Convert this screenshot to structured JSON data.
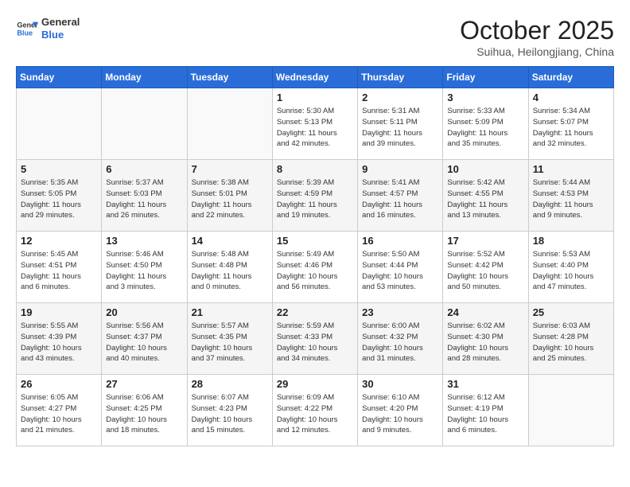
{
  "logo": {
    "line1": "General",
    "line2": "Blue"
  },
  "title": "October 2025",
  "subtitle": "Suihua, Heilongjiang, China",
  "weekdays": [
    "Sunday",
    "Monday",
    "Tuesday",
    "Wednesday",
    "Thursday",
    "Friday",
    "Saturday"
  ],
  "weeks": [
    [
      {
        "day": "",
        "detail": ""
      },
      {
        "day": "",
        "detail": ""
      },
      {
        "day": "",
        "detail": ""
      },
      {
        "day": "1",
        "detail": "Sunrise: 5:30 AM\nSunset: 5:13 PM\nDaylight: 11 hours\nand 42 minutes."
      },
      {
        "day": "2",
        "detail": "Sunrise: 5:31 AM\nSunset: 5:11 PM\nDaylight: 11 hours\nand 39 minutes."
      },
      {
        "day": "3",
        "detail": "Sunrise: 5:33 AM\nSunset: 5:09 PM\nDaylight: 11 hours\nand 35 minutes."
      },
      {
        "day": "4",
        "detail": "Sunrise: 5:34 AM\nSunset: 5:07 PM\nDaylight: 11 hours\nand 32 minutes."
      }
    ],
    [
      {
        "day": "5",
        "detail": "Sunrise: 5:35 AM\nSunset: 5:05 PM\nDaylight: 11 hours\nand 29 minutes."
      },
      {
        "day": "6",
        "detail": "Sunrise: 5:37 AM\nSunset: 5:03 PM\nDaylight: 11 hours\nand 26 minutes."
      },
      {
        "day": "7",
        "detail": "Sunrise: 5:38 AM\nSunset: 5:01 PM\nDaylight: 11 hours\nand 22 minutes."
      },
      {
        "day": "8",
        "detail": "Sunrise: 5:39 AM\nSunset: 4:59 PM\nDaylight: 11 hours\nand 19 minutes."
      },
      {
        "day": "9",
        "detail": "Sunrise: 5:41 AM\nSunset: 4:57 PM\nDaylight: 11 hours\nand 16 minutes."
      },
      {
        "day": "10",
        "detail": "Sunrise: 5:42 AM\nSunset: 4:55 PM\nDaylight: 11 hours\nand 13 minutes."
      },
      {
        "day": "11",
        "detail": "Sunrise: 5:44 AM\nSunset: 4:53 PM\nDaylight: 11 hours\nand 9 minutes."
      }
    ],
    [
      {
        "day": "12",
        "detail": "Sunrise: 5:45 AM\nSunset: 4:51 PM\nDaylight: 11 hours\nand 6 minutes."
      },
      {
        "day": "13",
        "detail": "Sunrise: 5:46 AM\nSunset: 4:50 PM\nDaylight: 11 hours\nand 3 minutes."
      },
      {
        "day": "14",
        "detail": "Sunrise: 5:48 AM\nSunset: 4:48 PM\nDaylight: 11 hours\nand 0 minutes."
      },
      {
        "day": "15",
        "detail": "Sunrise: 5:49 AM\nSunset: 4:46 PM\nDaylight: 10 hours\nand 56 minutes."
      },
      {
        "day": "16",
        "detail": "Sunrise: 5:50 AM\nSunset: 4:44 PM\nDaylight: 10 hours\nand 53 minutes."
      },
      {
        "day": "17",
        "detail": "Sunrise: 5:52 AM\nSunset: 4:42 PM\nDaylight: 10 hours\nand 50 minutes."
      },
      {
        "day": "18",
        "detail": "Sunrise: 5:53 AM\nSunset: 4:40 PM\nDaylight: 10 hours\nand 47 minutes."
      }
    ],
    [
      {
        "day": "19",
        "detail": "Sunrise: 5:55 AM\nSunset: 4:39 PM\nDaylight: 10 hours\nand 43 minutes."
      },
      {
        "day": "20",
        "detail": "Sunrise: 5:56 AM\nSunset: 4:37 PM\nDaylight: 10 hours\nand 40 minutes."
      },
      {
        "day": "21",
        "detail": "Sunrise: 5:57 AM\nSunset: 4:35 PM\nDaylight: 10 hours\nand 37 minutes."
      },
      {
        "day": "22",
        "detail": "Sunrise: 5:59 AM\nSunset: 4:33 PM\nDaylight: 10 hours\nand 34 minutes."
      },
      {
        "day": "23",
        "detail": "Sunrise: 6:00 AM\nSunset: 4:32 PM\nDaylight: 10 hours\nand 31 minutes."
      },
      {
        "day": "24",
        "detail": "Sunrise: 6:02 AM\nSunset: 4:30 PM\nDaylight: 10 hours\nand 28 minutes."
      },
      {
        "day": "25",
        "detail": "Sunrise: 6:03 AM\nSunset: 4:28 PM\nDaylight: 10 hours\nand 25 minutes."
      }
    ],
    [
      {
        "day": "26",
        "detail": "Sunrise: 6:05 AM\nSunset: 4:27 PM\nDaylight: 10 hours\nand 21 minutes."
      },
      {
        "day": "27",
        "detail": "Sunrise: 6:06 AM\nSunset: 4:25 PM\nDaylight: 10 hours\nand 18 minutes."
      },
      {
        "day": "28",
        "detail": "Sunrise: 6:07 AM\nSunset: 4:23 PM\nDaylight: 10 hours\nand 15 minutes."
      },
      {
        "day": "29",
        "detail": "Sunrise: 6:09 AM\nSunset: 4:22 PM\nDaylight: 10 hours\nand 12 minutes."
      },
      {
        "day": "30",
        "detail": "Sunrise: 6:10 AM\nSunset: 4:20 PM\nDaylight: 10 hours\nand 9 minutes."
      },
      {
        "day": "31",
        "detail": "Sunrise: 6:12 AM\nSunset: 4:19 PM\nDaylight: 10 hours\nand 6 minutes."
      },
      {
        "day": "",
        "detail": ""
      }
    ]
  ]
}
